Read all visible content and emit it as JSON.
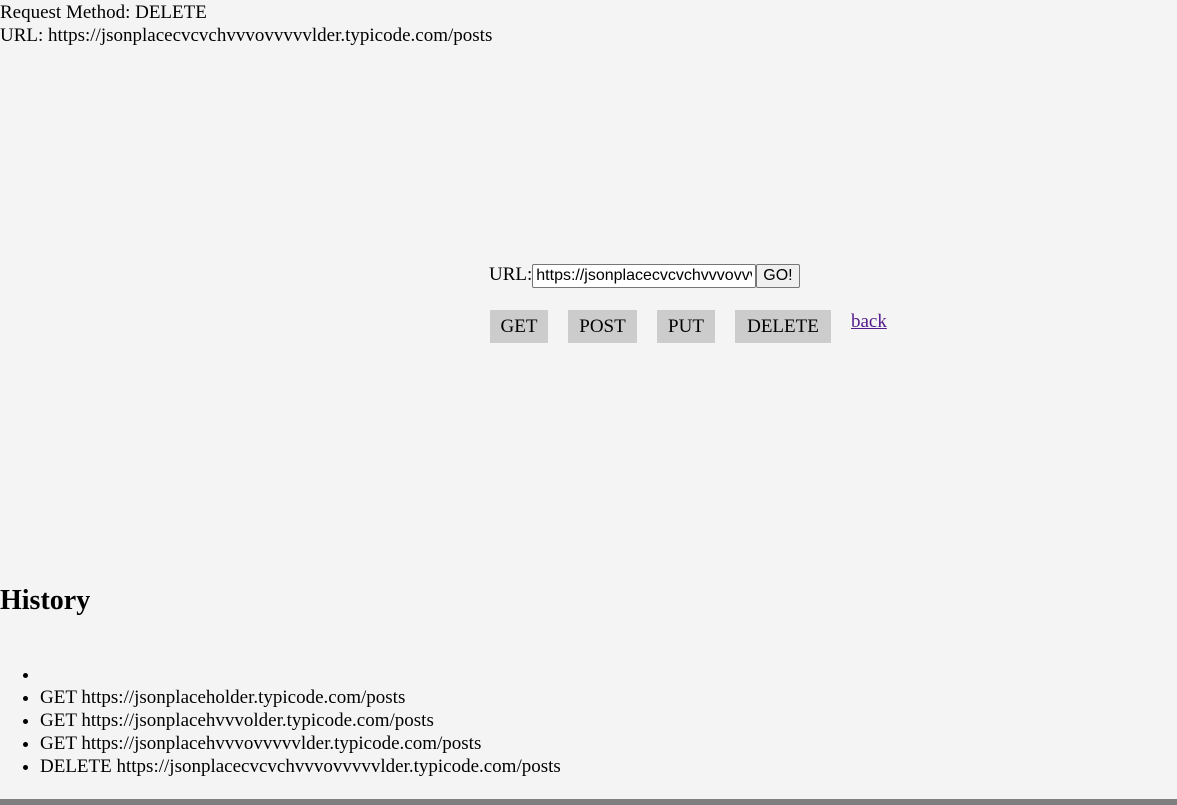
{
  "request": {
    "method_line": "Request Method: DELETE",
    "url_line": "URL: https://jsonplacecvcvchvvvovvvvvlder.typicode.com/posts"
  },
  "form": {
    "url_label": "URL:",
    "url_value": "https://jsonplacecvcvchvvvovvvvvlder.typicode.com/posts",
    "go_label": "GO!"
  },
  "methods": {
    "get": "GET",
    "post": "POST",
    "put": "PUT",
    "delete": "DELETE"
  },
  "back_link": "back",
  "history": {
    "title": "History",
    "items": [
      "",
      "GET https://jsonplaceholder.typicode.com/posts",
      "GET https://jsonplacehvvvolder.typicode.com/posts",
      "GET https://jsonplacehvvvovvvvvlder.typicode.com/posts",
      "DELETE https://jsonplacecvcvchvvvovvvvvlder.typicode.com/posts"
    ]
  },
  "colors": {
    "background": "#f4f4f4",
    "button_gray": "#cccccc",
    "link_visited": "#551a8b",
    "bottom_bar": "#7f7f7f"
  }
}
